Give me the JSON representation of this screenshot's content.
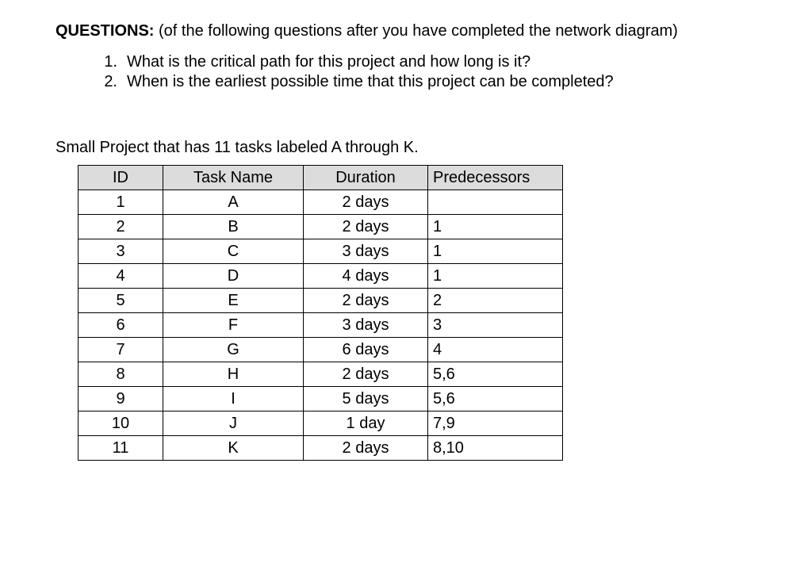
{
  "heading_label": "QUESTIONS:",
  "heading_rest": " (of the following questions after you have completed the network diagram)",
  "questions": [
    "What is the critical path for this project and how long is it?",
    "When is the earliest possible time that this project can be completed?"
  ],
  "subheading": "Small Project that has 11 tasks labeled A through K.",
  "table": {
    "headers": {
      "id": "ID",
      "name": "Task Name",
      "duration": "Duration",
      "predecessors": "Predecessors"
    },
    "rows": [
      {
        "id": "1",
        "name": "A",
        "duration": "2 days",
        "predecessors": ""
      },
      {
        "id": "2",
        "name": "B",
        "duration": "2 days",
        "predecessors": "1"
      },
      {
        "id": "3",
        "name": "C",
        "duration": "3 days",
        "predecessors": "1"
      },
      {
        "id": "4",
        "name": "D",
        "duration": "4 days",
        "predecessors": "1"
      },
      {
        "id": "5",
        "name": "E",
        "duration": "2 days",
        "predecessors": "2"
      },
      {
        "id": "6",
        "name": "F",
        "duration": "3 days",
        "predecessors": "3"
      },
      {
        "id": "7",
        "name": "G",
        "duration": "6 days",
        "predecessors": "4"
      },
      {
        "id": "8",
        "name": "H",
        "duration": "2 days",
        "predecessors": "5,6"
      },
      {
        "id": "9",
        "name": "I",
        "duration": "5 days",
        "predecessors": "5,6"
      },
      {
        "id": "10",
        "name": "J",
        "duration": "1 day",
        "predecessors": "7,9"
      },
      {
        "id": "11",
        "name": "K",
        "duration": "2 days",
        "predecessors": "8,10"
      }
    ]
  }
}
